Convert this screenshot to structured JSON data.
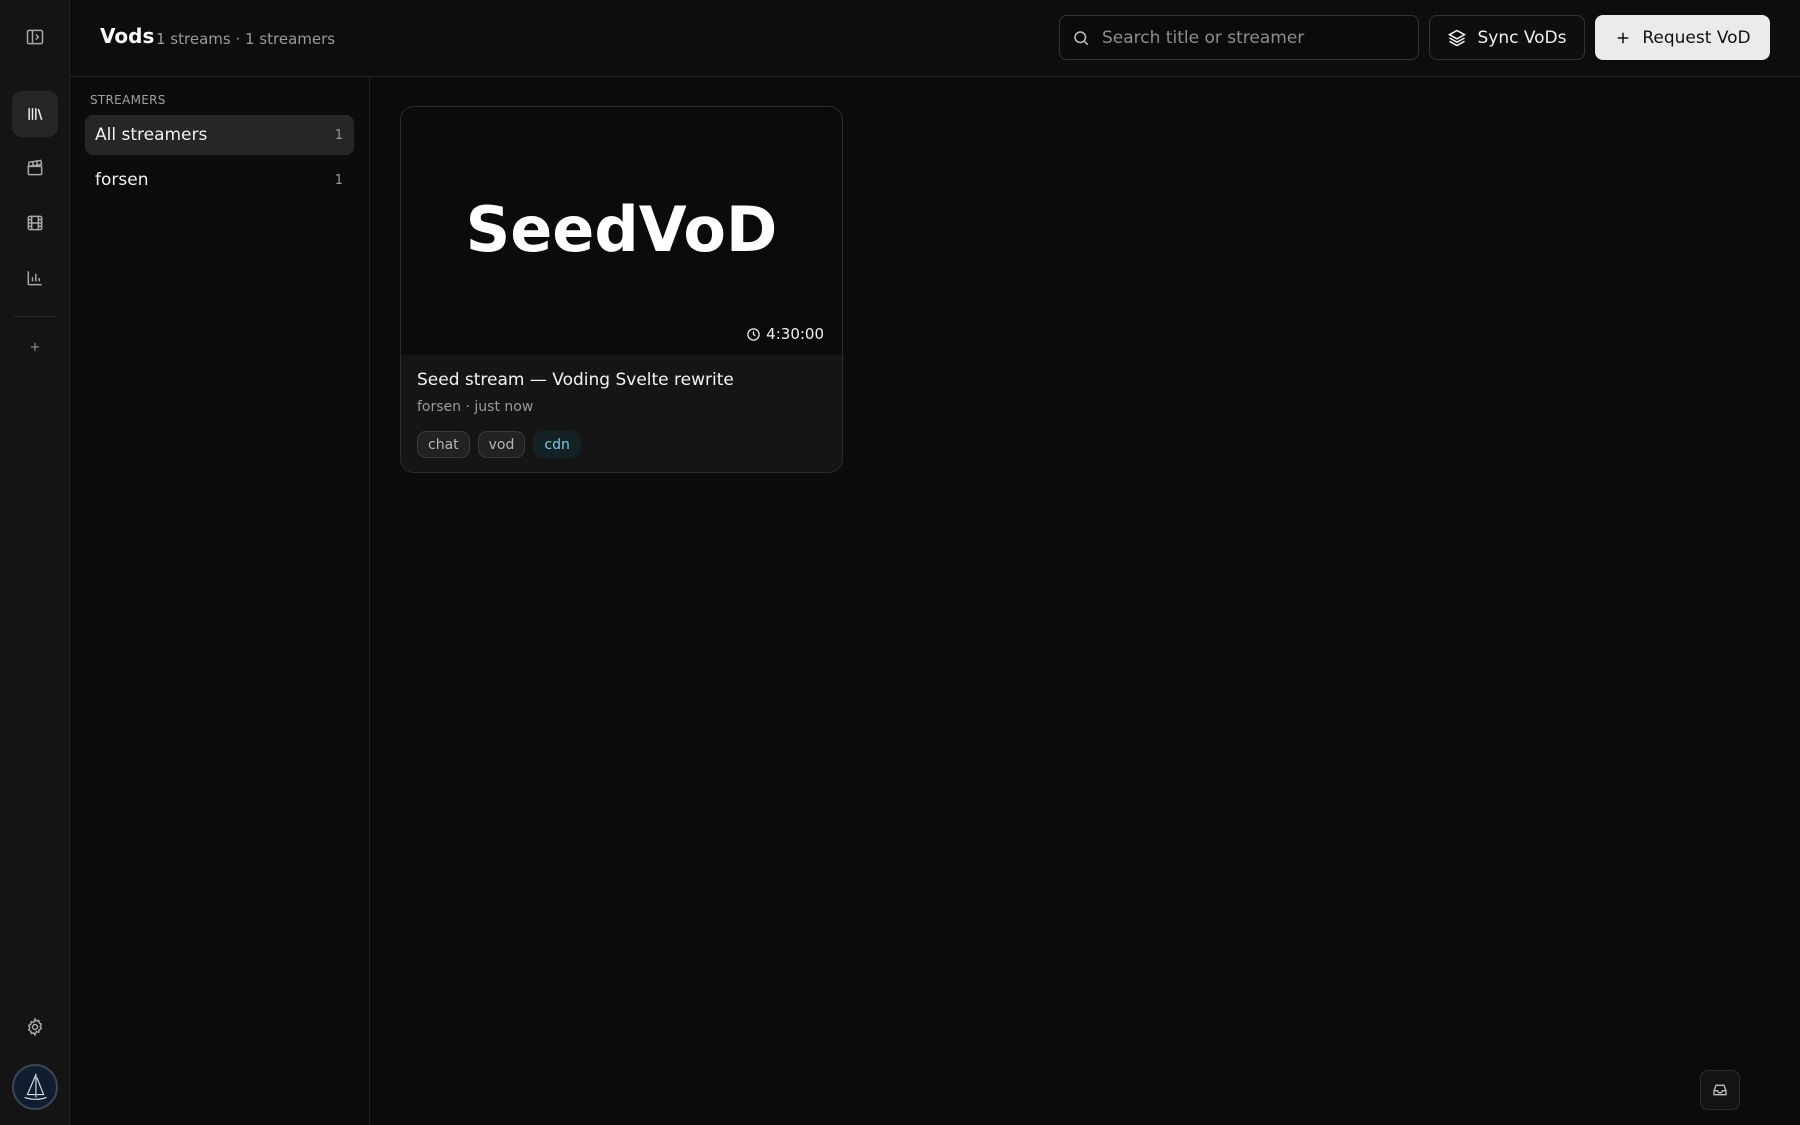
{
  "header": {
    "title": "Vods",
    "meta": "1 streams · 1 streamers",
    "search_placeholder": "Search title or streamer",
    "sync_label": "Sync VoDs",
    "request_label": "Request VoD"
  },
  "rail": {
    "icons": [
      "sidebar-toggle-icon",
      "library-icon",
      "clapperboard-icon",
      "film-icon",
      "bar-chart-icon",
      "plus-icon",
      "gear-icon"
    ],
    "active": "library-icon"
  },
  "streamers": {
    "heading": "STREAMERS",
    "items": [
      {
        "name": "All streamers",
        "count": "1",
        "active": true
      },
      {
        "name": "forsen",
        "count": "1",
        "active": false
      }
    ]
  },
  "vods": [
    {
      "thumbnail_text": "SeedVoD",
      "duration": "4:30:00",
      "title": "Seed stream — Voding Svelte rewrite",
      "subtitle": "forsen · just now",
      "tags": [
        {
          "label": "chat",
          "accent": false
        },
        {
          "label": "vod",
          "accent": false
        },
        {
          "label": "cdn",
          "accent": true
        }
      ]
    }
  ],
  "colors": {
    "background": "#0b0b0b",
    "rail": "#141414",
    "accent_tag_text": "#7ec8e3",
    "primary_button": "#ebebeb"
  }
}
